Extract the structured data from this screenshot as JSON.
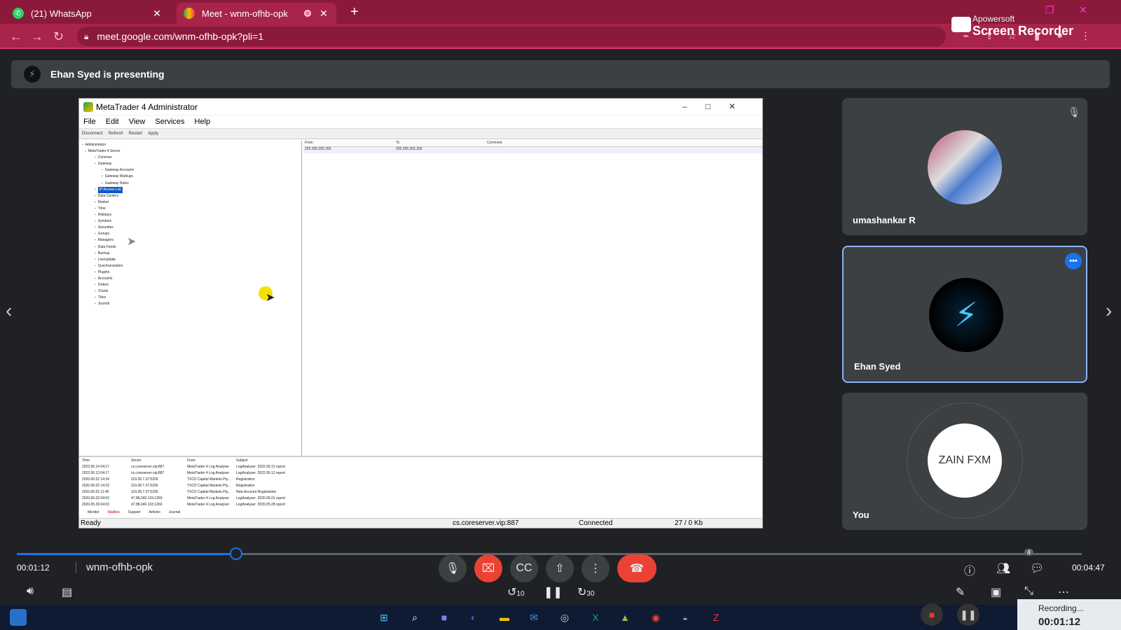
{
  "browser": {
    "tabs": [
      {
        "title": "(21) WhatsApp",
        "active": false
      },
      {
        "title": "Meet - wnm-ofhb-opk",
        "active": true
      }
    ],
    "url": "meet.google.com/wnm-ofhb-opk?pli=1",
    "recorder_brand_small": "Apowersoft",
    "recorder_brand_big": "Screen Recorder",
    "accent": "#8b1a3a"
  },
  "meet": {
    "presenting_banner": "Ehan Syed is presenting",
    "meeting_code": "wnm-ofhb-opk",
    "participants": [
      {
        "name": "umashankar R",
        "muted": true
      },
      {
        "name": "Ehan Syed",
        "active_speaker": true
      },
      {
        "name": "You",
        "avatar_text": "ZAIN FXM"
      }
    ],
    "people_count": "4"
  },
  "shared_screen": {
    "window_title": "MetaTrader 4 Administrator",
    "menu": [
      "File",
      "Edit",
      "View",
      "Services",
      "Help"
    ],
    "toolbar": [
      "Disconnect",
      "Refresh",
      "Restart",
      "Apply"
    ],
    "tree": [
      "Administrator",
      "MetaTrader 4 Server",
      "Common",
      "Gateway",
      "Gateway Accounts",
      "Gateway Markups",
      "Gateway Rules",
      "IP Access List",
      "Data Centers",
      "Market",
      "Time",
      "Holidays",
      "Symbols",
      "Securities",
      "Groups",
      "Managers",
      "Data Feeds",
      "Backup",
      "LiveUpdate",
      "Synchronization",
      "Plugins",
      "Accounts",
      "Orders",
      "Charts",
      "Ticks",
      "Journal"
    ],
    "selected_tree_item": "IP Access List",
    "grid_headers": [
      "From",
      "To",
      "Comment"
    ],
    "grid_rows": [
      [
        "255.255.255.255",
        "255.255.255.255",
        ""
      ]
    ],
    "log_headers": [
      "Time",
      "Server",
      "From",
      "Subject"
    ],
    "log_rows": [
      [
        "2022.06.14 04:17",
        "cs.coreserver.vip:887",
        "MetaTrader 4 Log Analyser",
        "LogAnalyser: 2022.06.13 report"
      ],
      [
        "2022.06.13 04:17",
        "cs.coreserver.vip:887",
        "MetaTrader 4 Log Analyser",
        "LogAnalyser: 2022.06.12 report"
      ],
      [
        "2020.06.02 14:24",
        "119.28.7.37:5200",
        "TXCD Capital Markets Pty...",
        "Registration"
      ],
      [
        "2020.06.02 14:23",
        "119.28.7.37:5200",
        "TXCD Capital Markets Pty...",
        "Registration"
      ],
      [
        "2020.06.02 11:45",
        "119.28.7.37:5200",
        "TXCD Capital Markets Pty...",
        "New Account Registration"
      ],
      [
        "2020.06.02 04:03",
        "47.88.240.133:1269",
        "MetaTrader 4 Log Analyser",
        "LogAnalyser: 2020.06.01 report"
      ],
      [
        "2020.05.29 04:03",
        "47.88.240.133:1269",
        "MetaTrader 4 Log Analyser",
        "LogAnalyser: 2020.05.28 report"
      ]
    ],
    "log_tabs": [
      "Monitor",
      "Mailbox",
      "Support",
      "Articles",
      "Journal"
    ],
    "status": {
      "left": "Ready",
      "server": "cs.coreserver.vip:887",
      "conn": "Connected",
      "traffic": "27 / 0 Kb"
    }
  },
  "player": {
    "elapsed": "00:01:12",
    "remaining": "00:04:47",
    "progress_fraction": 0.206,
    "skip_back": "10",
    "skip_forward": "30"
  },
  "recorder": {
    "label": "Recording...",
    "time": "00:01:12"
  }
}
